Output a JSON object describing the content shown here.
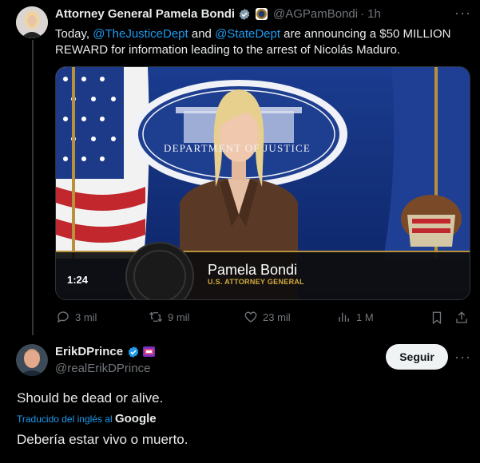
{
  "tweet1": {
    "name": "Attorney General Pamela Bondi",
    "handle": "@AGPamBondi",
    "time": "· 1h",
    "text_part1": "Today, ",
    "mention1": "@TheJusticeDept",
    "text_part2": " and ",
    "mention2": "@StateDept",
    "text_part3": " are announcing a $50 MILLION REWARD for information leading to the arrest of Nicolás Maduro.",
    "video": {
      "duration": "1:24",
      "seal_text": "DEPARTMENT OF JUSTICE",
      "lower_third_name": "Pamela Bondi",
      "lower_third_title": "U.S. ATTORNEY GENERAL"
    },
    "actions": {
      "replies": "3 mil",
      "reposts": "9 mil",
      "likes": "23 mil",
      "views": "1 M"
    }
  },
  "tweet2": {
    "name": "ErikDPrince",
    "handle": "@realErikDPrince",
    "follow_label": "Seguir",
    "text": "Should be dead or alive.",
    "translated_label": "Traducido del inglés al",
    "translator": "Google",
    "translation": "Debería estar vivo o muerto."
  },
  "colors": {
    "accent": "#1d9bf0",
    "muted": "#71767b",
    "background": "#000000"
  }
}
